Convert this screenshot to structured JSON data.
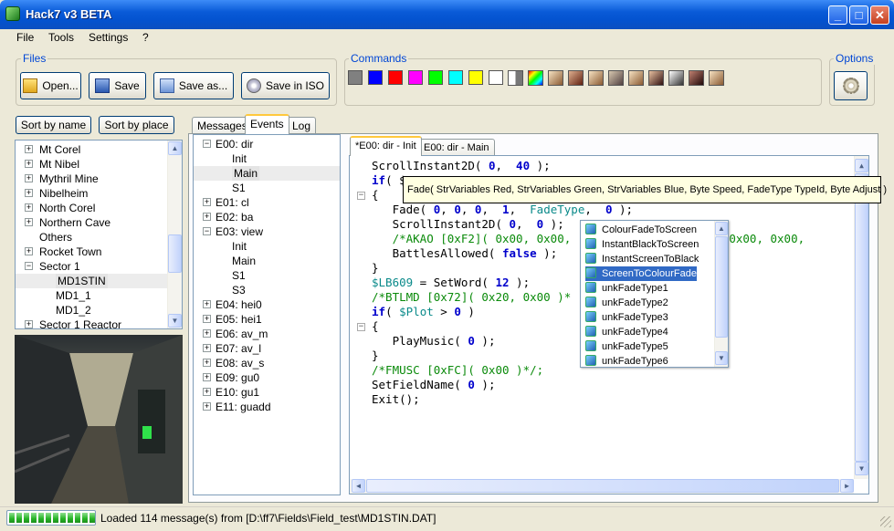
{
  "window": {
    "title": "Hack7 v3 BETA",
    "minimize": "_",
    "maximize": "□",
    "close": "✕"
  },
  "menu": [
    "File",
    "Tools",
    "Settings",
    "?"
  ],
  "files_group": {
    "label": "Files",
    "buttons": [
      "Open...",
      "Save",
      "Save as...",
      "Save in ISO"
    ]
  },
  "commands_group": {
    "label": "Commands",
    "colors": [
      "#808080",
      "#0000ff",
      "#ff0000",
      "#ff00ff",
      "#00ff00",
      "#00ffff",
      "#ffff00",
      "#ffffff"
    ]
  },
  "options_group": {
    "label": "Options"
  },
  "sort_buttons": [
    "Sort by name",
    "Sort by place"
  ],
  "location_tree": [
    {
      "label": "Mt Corel",
      "expander": "+"
    },
    {
      "label": "Mt Nibel",
      "expander": "+"
    },
    {
      "label": "Mythril Mine",
      "expander": "+"
    },
    {
      "label": "Nibelheim",
      "expander": "+"
    },
    {
      "label": "North Corel",
      "expander": "+"
    },
    {
      "label": "Northern Cave",
      "expander": "+"
    },
    {
      "label": "Others",
      "expander": ""
    },
    {
      "label": "Rocket Town",
      "expander": "+"
    },
    {
      "label": "Sector 1",
      "expander": "−"
    },
    {
      "label": "MD1STIN",
      "child": true,
      "selected": true
    },
    {
      "label": "MD1_1",
      "child": true
    },
    {
      "label": "MD1_2",
      "child": true
    },
    {
      "label": "Sector 1 Reactor",
      "expander": "+"
    }
  ],
  "main_tabs": [
    "Messages",
    "Events",
    "Log"
  ],
  "events_tree": [
    {
      "label": "E00: dir",
      "expander": "−"
    },
    {
      "label": "Init",
      "child": true
    },
    {
      "label": "Main",
      "child": true,
      "selected": true
    },
    {
      "label": "S1",
      "child": true
    },
    {
      "label": "E01: cl",
      "expander": "+"
    },
    {
      "label": "E02: ba",
      "expander": "+"
    },
    {
      "label": "E03: view",
      "expander": "−"
    },
    {
      "label": "Init",
      "child": true
    },
    {
      "label": "Main",
      "child": true
    },
    {
      "label": "S1",
      "child": true
    },
    {
      "label": "S3",
      "child": true
    },
    {
      "label": "E04: hei0",
      "expander": "+"
    },
    {
      "label": "E05: hei1",
      "expander": "+"
    },
    {
      "label": "E06: av_m",
      "expander": "+"
    },
    {
      "label": "E07: av_l",
      "expander": "+"
    },
    {
      "label": "E08: av_s",
      "expander": "+"
    },
    {
      "label": "E09: gu0",
      "expander": "+"
    },
    {
      "label": "E10: gu1",
      "expander": "+"
    },
    {
      "label": "E11: guadd",
      "expander": "+"
    }
  ],
  "editor_tabs": [
    "*E00: dir - Init",
    "E00: dir - Main"
  ],
  "code_lines": [
    [
      [
        "ScrollInstant2D( ",
        ""
      ],
      [
        "0",
        "num"
      ],
      [
        ",  ",
        ""
      ],
      [
        "40",
        "num"
      ],
      [
        " );",
        ""
      ]
    ],
    [
      [
        "if",
        "kw"
      ],
      [
        "( $",
        ""
      ]
    ],
    [
      [
        "{",
        ""
      ]
    ],
    [
      [
        "   Fade( ",
        ""
      ],
      [
        "0",
        "num"
      ],
      [
        ", ",
        ""
      ],
      [
        "0",
        "num"
      ],
      [
        ", ",
        ""
      ],
      [
        "0",
        "num"
      ],
      [
        ",  ",
        ""
      ],
      [
        "1",
        "num"
      ],
      [
        ",  ",
        ""
      ],
      [
        "FadeType",
        "var"
      ],
      [
        ",  ",
        ""
      ],
      [
        "0",
        "num"
      ],
      [
        " );",
        ""
      ]
    ],
    [
      [
        "   ScrollInstant2D( ",
        ""
      ],
      [
        "0",
        "num"
      ],
      [
        ",  ",
        ""
      ],
      [
        "0",
        "num"
      ],
      [
        " );",
        ""
      ]
    ],
    [
      [
        "   /*AKAO [0xF2]( 0x00, 0x00,",
        "cmt"
      ],
      [
        "                  ",
        ""
      ],
      [
        "x00, 0x00, 0x00,",
        "cmt"
      ]
    ],
    [
      [
        "   BattlesAllowed( ",
        ""
      ],
      [
        "false",
        "kw"
      ],
      [
        " );",
        ""
      ]
    ],
    [
      [
        "}",
        ""
      ]
    ],
    [
      [
        "$LB609",
        "var"
      ],
      [
        " = SetWord( ",
        ""
      ],
      [
        "12",
        "num"
      ],
      [
        " );",
        ""
      ]
    ],
    [
      [
        "/*BTLMD [0x72]( 0x20, 0x00 )*",
        "cmt"
      ]
    ],
    [
      [
        "if",
        "kw"
      ],
      [
        "( ",
        ""
      ],
      [
        "$Plot",
        "var"
      ],
      [
        " > ",
        ""
      ],
      [
        "0",
        "num"
      ],
      [
        " )",
        ""
      ]
    ],
    [
      [
        "{",
        ""
      ]
    ],
    [
      [
        "   PlayMusic( ",
        ""
      ],
      [
        "0",
        "num"
      ],
      [
        " );",
        ""
      ]
    ],
    [
      [
        "}",
        ""
      ]
    ],
    [
      [
        "/*FMUSC [0xFC]( 0x00 )*/;",
        "cmt"
      ]
    ],
    [
      [
        "SetFieldName( ",
        ""
      ],
      [
        "0",
        "num"
      ],
      [
        " );",
        ""
      ]
    ],
    [
      [
        "Exit();",
        ""
      ]
    ]
  ],
  "tooltip": "Fade( StrVariables Red, StrVariables Green, StrVariables Blue,  Byte Speed,  FadeType TypeId,  Byte Adjust )",
  "autocomplete": [
    "ColourFadeToScreen",
    "InstantBlackToScreen",
    "InstantScreenToBlack",
    "ScreenToColourFade",
    "unkFadeType1",
    "unkFadeType2",
    "unkFadeType3",
    "unkFadeType4",
    "unkFadeType5",
    "unkFadeType6"
  ],
  "autocomplete_selected": 3,
  "status": {
    "message": "Loaded 114 message(s) from [D:\\ff7\\Fields\\Field_test\\MD1STIN.DAT]",
    "progress": 1.0
  }
}
